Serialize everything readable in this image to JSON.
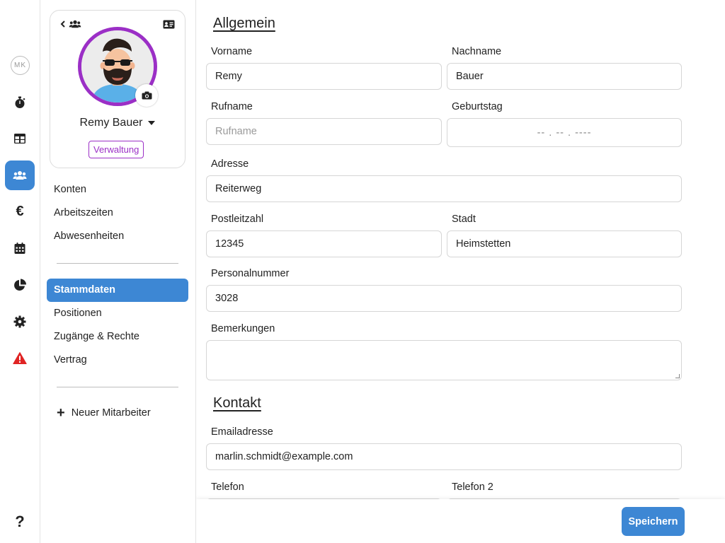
{
  "rail": {
    "user_initials": "MK",
    "items": [
      {
        "icon": "stopwatch-icon"
      },
      {
        "icon": "table-icon"
      },
      {
        "icon": "users-icon",
        "active": true
      },
      {
        "icon": "euro-icon",
        "glyph": "€"
      },
      {
        "icon": "calendar-icon"
      },
      {
        "icon": "pie-chart-icon"
      },
      {
        "icon": "gear-icon"
      },
      {
        "icon": "warning-icon"
      }
    ],
    "help_glyph": "?"
  },
  "profile": {
    "name": "Remy Bauer",
    "role": "Verwaltung"
  },
  "nav": {
    "group1": [
      "Konten",
      "Arbeitszeiten",
      "Abwesenheiten"
    ],
    "group2": [
      "Stammdaten",
      "Positionen",
      "Zugänge & Rechte",
      "Vertrag"
    ],
    "active": "Stammdaten",
    "new_employee": "Neuer Mitarbeiter"
  },
  "form": {
    "section_general": "Allgemein",
    "first_name_label": "Vorname",
    "first_name_value": "Remy",
    "last_name_label": "Nachname",
    "last_name_value": "Bauer",
    "nickname_label": "Rufname",
    "nickname_placeholder": "Rufname",
    "birthday_label": "Geburtstag",
    "birthday_placeholder": "-- . -- . ----",
    "address_label": "Adresse",
    "address_value": "Reiterweg",
    "zip_label": "Postleitzahl",
    "zip_value": "12345",
    "city_label": "Stadt",
    "city_value": "Heimstetten",
    "staff_number_label": "Personalnummer",
    "staff_number_value": "3028",
    "remarks_label": "Bemerkungen",
    "remarks_value": "",
    "section_contact": "Kontakt",
    "email_label": "Emailadresse",
    "email_value": "marlin.schmidt@example.com",
    "phone_label": "Telefon",
    "phone2_label": "Telefon 2"
  },
  "footer": {
    "save_label": "Speichern"
  },
  "colors": {
    "accent": "#3d87d4",
    "role_purple": "#9b2fc6",
    "warning_red": "#e02424"
  }
}
